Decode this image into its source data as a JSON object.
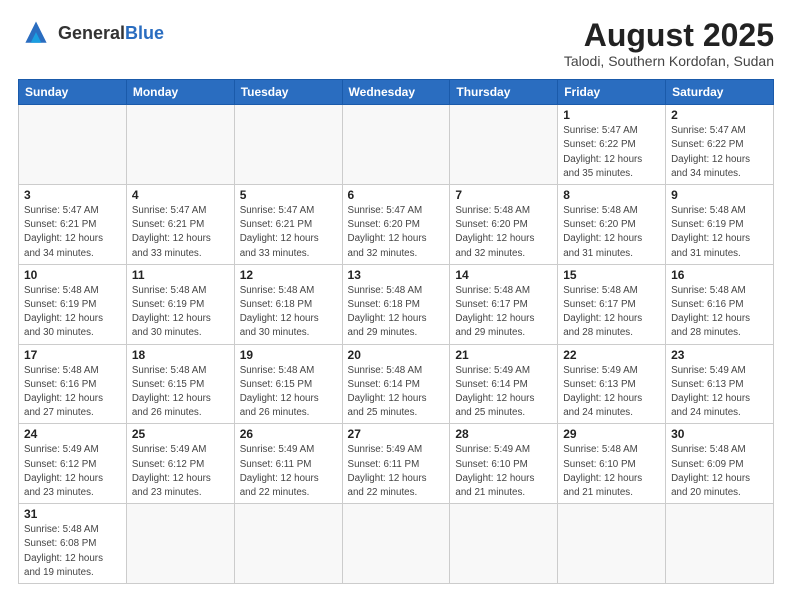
{
  "header": {
    "logo_general": "General",
    "logo_blue": "Blue",
    "title": "August 2025",
    "subtitle": "Talodi, Southern Kordofan, Sudan"
  },
  "weekdays": [
    "Sunday",
    "Monday",
    "Tuesday",
    "Wednesday",
    "Thursday",
    "Friday",
    "Saturday"
  ],
  "weeks": [
    [
      {
        "day": "",
        "info": ""
      },
      {
        "day": "",
        "info": ""
      },
      {
        "day": "",
        "info": ""
      },
      {
        "day": "",
        "info": ""
      },
      {
        "day": "",
        "info": ""
      },
      {
        "day": "1",
        "info": "Sunrise: 5:47 AM\nSunset: 6:22 PM\nDaylight: 12 hours\nand 35 minutes."
      },
      {
        "day": "2",
        "info": "Sunrise: 5:47 AM\nSunset: 6:22 PM\nDaylight: 12 hours\nand 34 minutes."
      }
    ],
    [
      {
        "day": "3",
        "info": "Sunrise: 5:47 AM\nSunset: 6:21 PM\nDaylight: 12 hours\nand 34 minutes."
      },
      {
        "day": "4",
        "info": "Sunrise: 5:47 AM\nSunset: 6:21 PM\nDaylight: 12 hours\nand 33 minutes."
      },
      {
        "day": "5",
        "info": "Sunrise: 5:47 AM\nSunset: 6:21 PM\nDaylight: 12 hours\nand 33 minutes."
      },
      {
        "day": "6",
        "info": "Sunrise: 5:47 AM\nSunset: 6:20 PM\nDaylight: 12 hours\nand 32 minutes."
      },
      {
        "day": "7",
        "info": "Sunrise: 5:48 AM\nSunset: 6:20 PM\nDaylight: 12 hours\nand 32 minutes."
      },
      {
        "day": "8",
        "info": "Sunrise: 5:48 AM\nSunset: 6:20 PM\nDaylight: 12 hours\nand 31 minutes."
      },
      {
        "day": "9",
        "info": "Sunrise: 5:48 AM\nSunset: 6:19 PM\nDaylight: 12 hours\nand 31 minutes."
      }
    ],
    [
      {
        "day": "10",
        "info": "Sunrise: 5:48 AM\nSunset: 6:19 PM\nDaylight: 12 hours\nand 30 minutes."
      },
      {
        "day": "11",
        "info": "Sunrise: 5:48 AM\nSunset: 6:19 PM\nDaylight: 12 hours\nand 30 minutes."
      },
      {
        "day": "12",
        "info": "Sunrise: 5:48 AM\nSunset: 6:18 PM\nDaylight: 12 hours\nand 30 minutes."
      },
      {
        "day": "13",
        "info": "Sunrise: 5:48 AM\nSunset: 6:18 PM\nDaylight: 12 hours\nand 29 minutes."
      },
      {
        "day": "14",
        "info": "Sunrise: 5:48 AM\nSunset: 6:17 PM\nDaylight: 12 hours\nand 29 minutes."
      },
      {
        "day": "15",
        "info": "Sunrise: 5:48 AM\nSunset: 6:17 PM\nDaylight: 12 hours\nand 28 minutes."
      },
      {
        "day": "16",
        "info": "Sunrise: 5:48 AM\nSunset: 6:16 PM\nDaylight: 12 hours\nand 28 minutes."
      }
    ],
    [
      {
        "day": "17",
        "info": "Sunrise: 5:48 AM\nSunset: 6:16 PM\nDaylight: 12 hours\nand 27 minutes."
      },
      {
        "day": "18",
        "info": "Sunrise: 5:48 AM\nSunset: 6:15 PM\nDaylight: 12 hours\nand 26 minutes."
      },
      {
        "day": "19",
        "info": "Sunrise: 5:48 AM\nSunset: 6:15 PM\nDaylight: 12 hours\nand 26 minutes."
      },
      {
        "day": "20",
        "info": "Sunrise: 5:48 AM\nSunset: 6:14 PM\nDaylight: 12 hours\nand 25 minutes."
      },
      {
        "day": "21",
        "info": "Sunrise: 5:49 AM\nSunset: 6:14 PM\nDaylight: 12 hours\nand 25 minutes."
      },
      {
        "day": "22",
        "info": "Sunrise: 5:49 AM\nSunset: 6:13 PM\nDaylight: 12 hours\nand 24 minutes."
      },
      {
        "day": "23",
        "info": "Sunrise: 5:49 AM\nSunset: 6:13 PM\nDaylight: 12 hours\nand 24 minutes."
      }
    ],
    [
      {
        "day": "24",
        "info": "Sunrise: 5:49 AM\nSunset: 6:12 PM\nDaylight: 12 hours\nand 23 minutes."
      },
      {
        "day": "25",
        "info": "Sunrise: 5:49 AM\nSunset: 6:12 PM\nDaylight: 12 hours\nand 23 minutes."
      },
      {
        "day": "26",
        "info": "Sunrise: 5:49 AM\nSunset: 6:11 PM\nDaylight: 12 hours\nand 22 minutes."
      },
      {
        "day": "27",
        "info": "Sunrise: 5:49 AM\nSunset: 6:11 PM\nDaylight: 12 hours\nand 22 minutes."
      },
      {
        "day": "28",
        "info": "Sunrise: 5:49 AM\nSunset: 6:10 PM\nDaylight: 12 hours\nand 21 minutes."
      },
      {
        "day": "29",
        "info": "Sunrise: 5:48 AM\nSunset: 6:10 PM\nDaylight: 12 hours\nand 21 minutes."
      },
      {
        "day": "30",
        "info": "Sunrise: 5:48 AM\nSunset: 6:09 PM\nDaylight: 12 hours\nand 20 minutes."
      }
    ],
    [
      {
        "day": "31",
        "info": "Sunrise: 5:48 AM\nSunset: 6:08 PM\nDaylight: 12 hours\nand 19 minutes."
      },
      {
        "day": "",
        "info": ""
      },
      {
        "day": "",
        "info": ""
      },
      {
        "day": "",
        "info": ""
      },
      {
        "day": "",
        "info": ""
      },
      {
        "day": "",
        "info": ""
      },
      {
        "day": "",
        "info": ""
      }
    ]
  ]
}
